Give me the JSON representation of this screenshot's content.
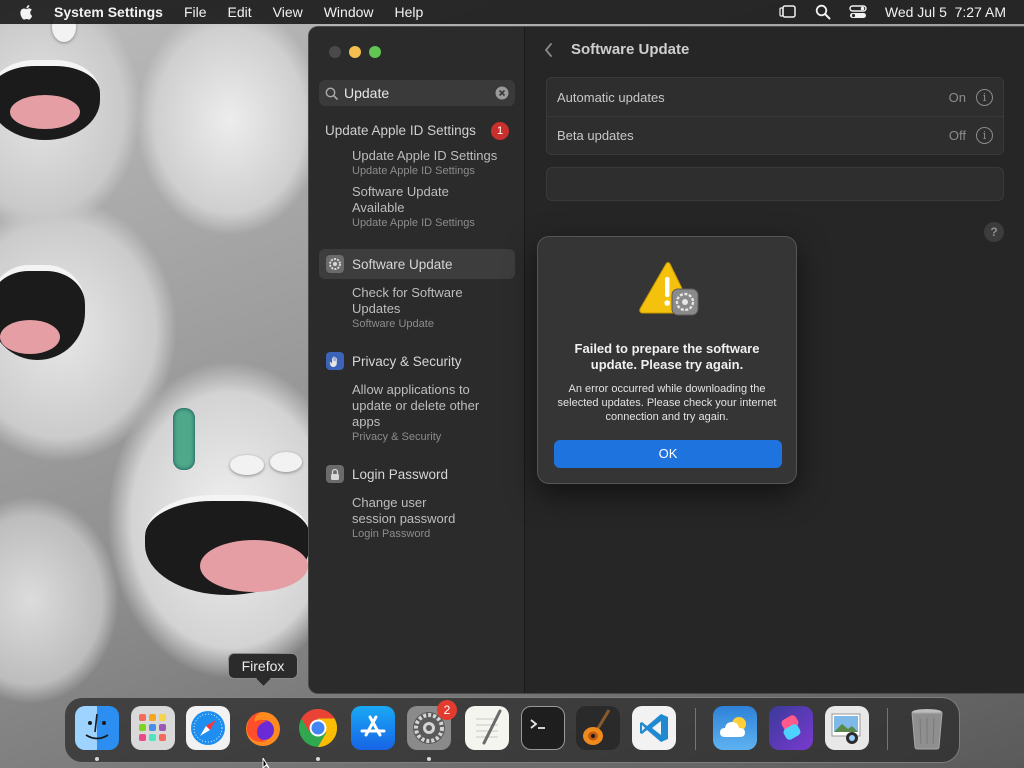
{
  "menubar": {
    "app_name": "System Settings",
    "items": [
      "File",
      "Edit",
      "View",
      "Window",
      "Help"
    ],
    "datetime": "Wed Jul 5  7:27 AM"
  },
  "sidebar": {
    "search_value": "Update",
    "groups": [
      {
        "header": "Update Apple ID Settings",
        "badge": "1",
        "subitems": [
          {
            "title": "Update Apple ID Settings",
            "subtitle": "Update Apple ID Settings"
          },
          {
            "title": "Software Update Available",
            "subtitle": "Update Apple ID Settings"
          }
        ]
      },
      {
        "label": "Software Update",
        "icon": "gear-icon",
        "selected": true,
        "subitems": [
          {
            "title": "Check for Software Updates",
            "subtitle": "Software Update"
          }
        ]
      },
      {
        "label": "Privacy & Security",
        "icon": "hand-icon",
        "subitems": [
          {
            "title": "Allow applications to update or delete other apps",
            "subtitle": "Privacy & Security"
          }
        ]
      },
      {
        "label": "Login Password",
        "icon": "lock-icon",
        "subitems": [
          {
            "title": "Change user session password",
            "subtitle": "Login Password"
          }
        ]
      }
    ]
  },
  "content": {
    "title": "Software Update",
    "rows": [
      {
        "label": "Automatic updates",
        "value": "On"
      },
      {
        "label": "Beta updates",
        "value": "Off"
      }
    ],
    "help": "?"
  },
  "alert": {
    "title": "Failed to prepare the software update. Please try again.",
    "message": "An error occurred while downloading the selected updates. Please check your internet connection and try again.",
    "ok_label": "OK"
  },
  "tooltip": "Firefox",
  "dock": {
    "apps": [
      {
        "name": "Finder",
        "running": true
      },
      {
        "name": "Launchpad",
        "running": false
      },
      {
        "name": "Safari",
        "running": false
      },
      {
        "name": "Firefox",
        "running": false
      },
      {
        "name": "Google Chrome",
        "running": true
      },
      {
        "name": "App Store",
        "running": false
      },
      {
        "name": "System Settings",
        "running": true,
        "badge": "2"
      },
      {
        "name": "TextEdit",
        "running": false
      },
      {
        "name": "Terminal",
        "running": false
      },
      {
        "name": "GarageBand",
        "running": false
      },
      {
        "name": "Visual Studio Code",
        "running": false
      },
      {
        "name": "Weather",
        "running": false
      },
      {
        "name": "Shortcuts",
        "running": false
      },
      {
        "name": "Preview",
        "running": false
      },
      {
        "name": "Trash",
        "running": false
      }
    ]
  },
  "colors": {
    "accent": "#1f73de",
    "badge": "#e33b2e",
    "traffic_red": "#ed6a5e",
    "traffic_yellow": "#f5bf4f",
    "traffic_green": "#61c554"
  }
}
